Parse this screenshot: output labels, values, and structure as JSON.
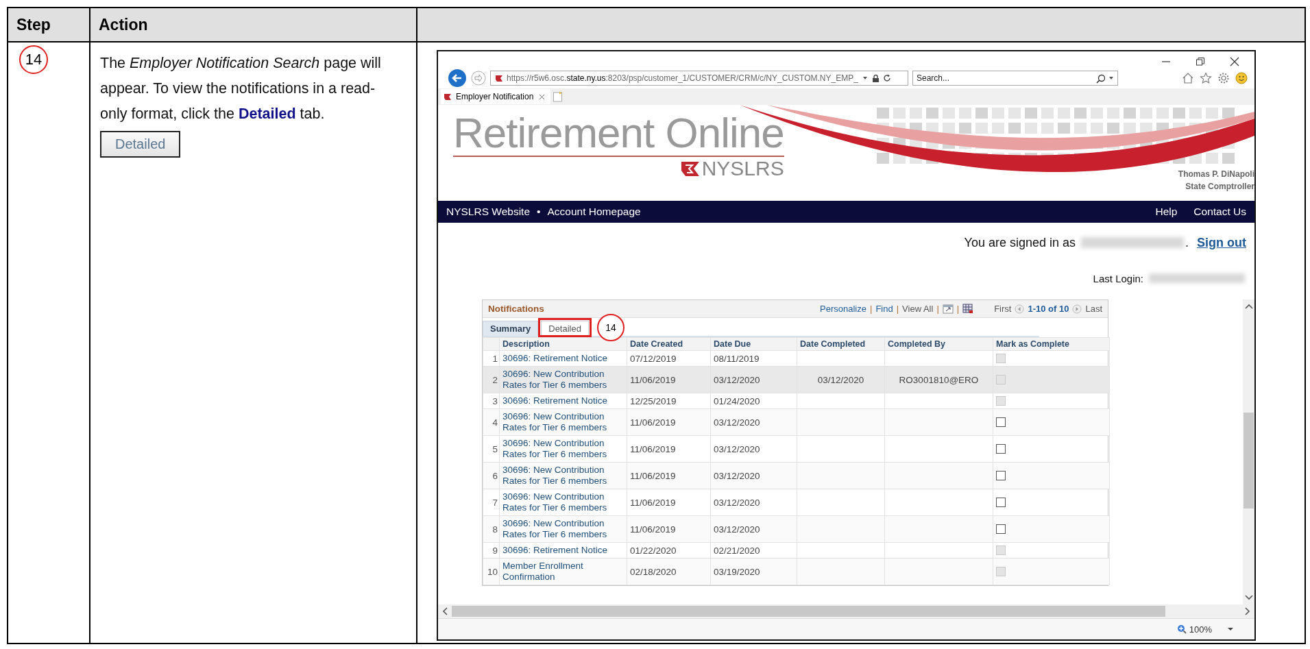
{
  "document": {
    "columns": [
      "Step",
      "Action"
    ],
    "step": {
      "number": "14",
      "instruction": "The *Employer Notification Search* page will appear. To view the notifications in a read-only format, click the **Detailed** tab.",
      "button_label": "Detailed"
    }
  },
  "browser": {
    "url": "https://r5w6.osc.**state.ny.us**:8203/psp/customer_1/CUSTOMER/CRM/c/NY_CUSTOM.NY_EMP_",
    "search": {
      "placeholder": "Search..."
    },
    "tab": {
      "title": "Employer Notification"
    },
    "zoom": "100%"
  },
  "site": {
    "title": "Retirement Online",
    "brand": "NYSLRS",
    "official": [
      "Thomas P. DiNapoli",
      "State Comptroller"
    ],
    "nav_left": [
      "NYSLRS Website",
      "Account Homepage"
    ],
    "nav_separator": "•",
    "nav_right": [
      "Help",
      "Contact Us"
    ],
    "signed_in": {
      "label": "You are signed in as",
      "suffix": ".",
      "sign_out": "Sign out"
    },
    "last_login": {
      "label": "Last Login:"
    }
  },
  "grid": {
    "title": "Notifications",
    "toolbar": {
      "personalize": "Personalize",
      "sep_1": "|",
      "find": "Find",
      "sep_2": "|",
      "view_all": "View All",
      "sep_3": "|",
      "sep_4": "|",
      "first": "First",
      "range": "1-10 of 10",
      "last": "Last"
    },
    "tabs": [
      {
        "label": "Summary",
        "selected": true
      },
      {
        "label": "Detailed",
        "selected": false
      }
    ],
    "callout": "14",
    "columns": [
      "Description",
      "Date Created",
      "Date Due",
      "Date Completed",
      "Completed By",
      "Mark as Complete"
    ],
    "rows": [
      {
        "number": "1",
        "description": "30696: Retirement Notice",
        "date_created": "07/12/2019",
        "date_due": "08/11/2019",
        "checked": false,
        "disabled": true,
        "highlighted": false
      },
      {
        "number": "2",
        "description": "30696: New Contribution Rates for Tier 6 members",
        "date_created": "11/06/2019",
        "date_due": "03/12/2020",
        "date_completed": "03/12/2020",
        "completed_by": "RO3001810@ERO",
        "checked": false,
        "disabled": true,
        "highlighted": true
      },
      {
        "number": "3",
        "description": "30696: Retirement Notice",
        "date_created": "12/25/2019",
        "date_due": "01/24/2020",
        "checked": false,
        "disabled": true,
        "highlighted": false
      },
      {
        "number": "4",
        "description": "30696: New Contribution Rates for Tier 6 members",
        "date_created": "11/06/2019",
        "date_due": "03/12/2020",
        "checked": false,
        "disabled": false,
        "highlighted": false
      },
      {
        "number": "5",
        "description": "30696: New Contribution Rates for Tier 6 members",
        "date_created": "11/06/2019",
        "date_due": "03/12/2020",
        "checked": false,
        "disabled": false,
        "highlighted": false
      },
      {
        "number": "6",
        "description": "30696: New Contribution Rates for Tier 6 members",
        "date_created": "11/06/2019",
        "date_due": "03/12/2020",
        "checked": false,
        "disabled": false,
        "highlighted": false
      },
      {
        "number": "7",
        "description": "30696: New Contribution Rates for Tier 6 members",
        "date_created": "11/06/2019",
        "date_due": "03/12/2020",
        "checked": false,
        "disabled": false,
        "highlighted": false
      },
      {
        "number": "8",
        "description": "30696: New Contribution Rates for Tier 6 members",
        "date_created": "11/06/2019",
        "date_due": "03/12/2020",
        "checked": false,
        "disabled": false,
        "highlighted": false
      },
      {
        "number": "9",
        "description": "30696: Retirement Notice",
        "date_created": "01/22/2020",
        "date_due": "02/21/2020",
        "checked": false,
        "disabled": true,
        "highlighted": false
      },
      {
        "number": "10",
        "description": "Member Enrollment Confirmation",
        "date_created": "02/18/2020",
        "date_due": "03/19/2020",
        "checked": false,
        "disabled": true,
        "highlighted": false
      }
    ]
  }
}
